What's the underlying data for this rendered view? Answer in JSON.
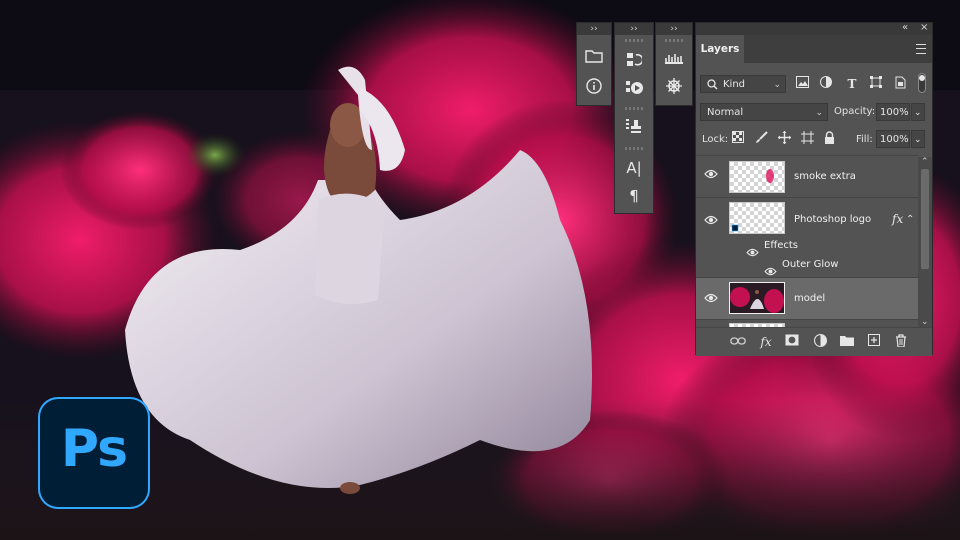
{
  "badge": {
    "label": "Ps",
    "accent": "#31a8ff",
    "bg": "#001e36"
  },
  "tool_strip": {
    "collapse_glyph": "››",
    "col1": [
      {
        "icon": "folder-icon"
      },
      {
        "icon": "info-icon",
        "glyph": "i"
      }
    ],
    "col2": [
      {
        "icon": "history-icon"
      },
      {
        "icon": "actions-icon"
      },
      {
        "icon": "clone-source-icon"
      },
      {
        "icon": "character-icon",
        "glyph": "A|"
      },
      {
        "icon": "paragraph-icon",
        "glyph": "¶"
      }
    ],
    "col3": [
      {
        "icon": "brushes-icon"
      },
      {
        "icon": "navigator-icon"
      }
    ]
  },
  "layers_panel": {
    "top_left_glyph": "«",
    "close_glyph": "×",
    "tab": "Layers",
    "filter": {
      "label": "Kind",
      "icon": "search-icon"
    },
    "filter_icons": [
      "image-filter-icon",
      "adjustment-filter-icon",
      "type-filter-icon",
      "shape-filter-icon",
      "smart-object-filter-icon",
      "filter-toggle-icon"
    ],
    "blend_mode": "Normal",
    "opacity_label": "Opacity:",
    "opacity_value": "100%",
    "lock_label": "Lock:",
    "fill_label": "Fill:",
    "fill_value": "100%",
    "layers": [
      {
        "name": "smoke extra",
        "visible": true,
        "selected": false
      },
      {
        "name": "Photoshop logo",
        "visible": true,
        "selected": false,
        "fx": "fx",
        "effects_label": "Effects",
        "effect_name": "Outer Glow"
      },
      {
        "name": "model",
        "visible": true,
        "selected": true
      }
    ],
    "bottom_icons": [
      "link-icon",
      "fx-icon",
      "mask-icon",
      "adjustment-icon",
      "group-folder-icon",
      "new-layer-icon",
      "trash-icon"
    ]
  },
  "colors": {
    "smoke": "#e0115f",
    "panel": "#535353",
    "panel_dark": "#393939"
  }
}
